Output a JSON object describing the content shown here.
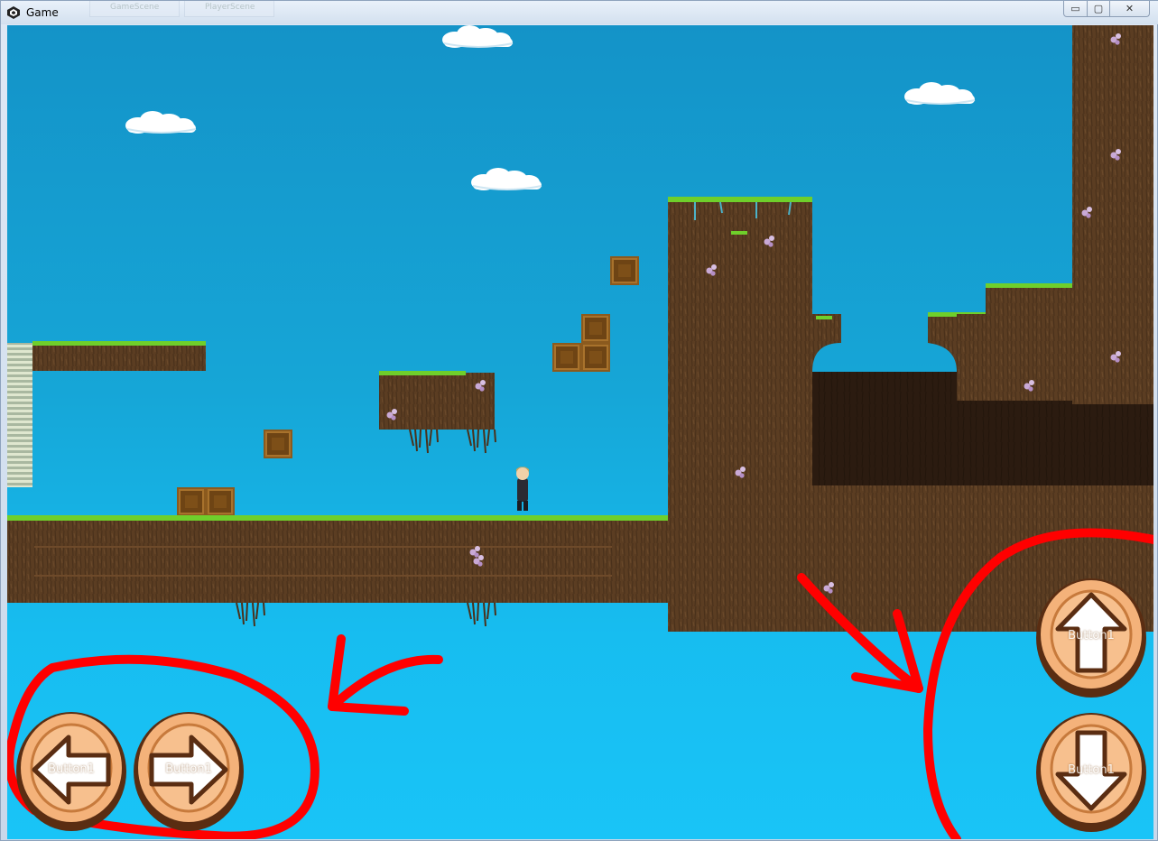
{
  "window": {
    "title": "Game",
    "ghost_tabs": [
      "GameScene",
      "PlayerScene"
    ],
    "controls": {
      "minimize": "▭",
      "maximize": "▢",
      "close": "✕"
    }
  },
  "hud": {
    "left_button": {
      "label": "Button1",
      "icon": "arrow-left-icon"
    },
    "right_button": {
      "label": "Button1",
      "icon": "arrow-right-icon"
    },
    "up_button": {
      "label": "Button1",
      "icon": "arrow-up-icon"
    },
    "down_button": {
      "label": "Button1",
      "icon": "arrow-down-icon"
    }
  },
  "colors": {
    "sky_top": "#1493c8",
    "sky_bottom": "#19c4f7",
    "dirt": "#5b3d22",
    "grass": "#6fcf2b",
    "cave": "#2b1b10",
    "crate": "#8b5a1e",
    "button_fill": "#f4b27a",
    "button_rim": "#5a2d12",
    "annotation": "#ff0000"
  }
}
